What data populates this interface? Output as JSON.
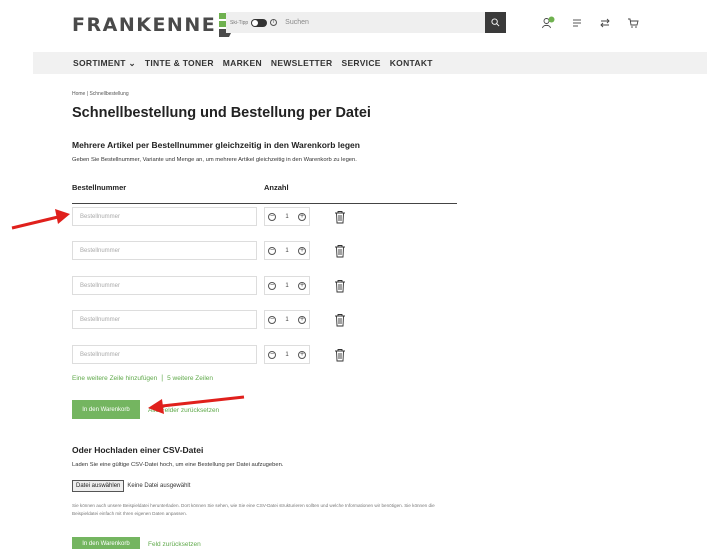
{
  "header": {
    "logo_text": "FRANKENNE",
    "ski_tipp_label": "Ski-Tipp",
    "search_placeholder": "Suchen"
  },
  "nav": {
    "items": [
      "SORTIMENT",
      "TINTE & TONER",
      "MARKEN",
      "NEWSLETTER",
      "SERVICE",
      "KONTAKT"
    ]
  },
  "breadcrumb": {
    "home": "Home",
    "separator": "|",
    "current": "Schnellbestellung"
  },
  "page_title": "Schnellbestellung und Bestellung per Datei",
  "multi": {
    "title": "Mehrere Artikel per Bestellnummer gleichzeitig in den Warenkorb legen",
    "description": "Geben Sie Bestellnummer, Variante und Menge an, um mehrere Artikel gleichzeitig in den Warenkorb zu legen.",
    "col_order": "Bestellnummer",
    "col_qty": "Anzahl",
    "rows": [
      {
        "placeholder": "Bestellnummer",
        "qty": "1"
      },
      {
        "placeholder": "Bestellnummer",
        "qty": "1"
      },
      {
        "placeholder": "Bestellnummer",
        "qty": "1"
      },
      {
        "placeholder": "Bestellnummer",
        "qty": "1"
      },
      {
        "placeholder": "Bestellnummer",
        "qty": "1"
      }
    ],
    "add_row": "Eine weitere Zeile hinzufügen",
    "link_sep": "|",
    "add_five": "5 weitere Zeilen",
    "cart_button": "In den Warenkorb",
    "reset_link": "Alle Felder zurücksetzen"
  },
  "csv": {
    "title": "Oder Hochladen einer CSV-Datei",
    "description": "Laden Sie eine gültige CSV-Datei hoch, um eine Bestellung per Datei aufzugeben.",
    "file_button": "Datei auswählen",
    "file_status": "Keine Datei ausgewählt",
    "note": "Sie können auch unsere Beispieldatei herunterladen. Dort können Sie sehen, wie Sie eine CSV-Datei strukturieren sollten und welche Informationen wir benötigen. Sie können die Beispieldatei einfach mit Ihren eigenen Daten anpassen.",
    "cart_button": "In den Warenkorb",
    "reset_link": "Feld zurücksetzen"
  },
  "colors": {
    "brand_green": "#74b560",
    "annotation_red": "#e0201c",
    "dark": "#3a3a3a"
  }
}
